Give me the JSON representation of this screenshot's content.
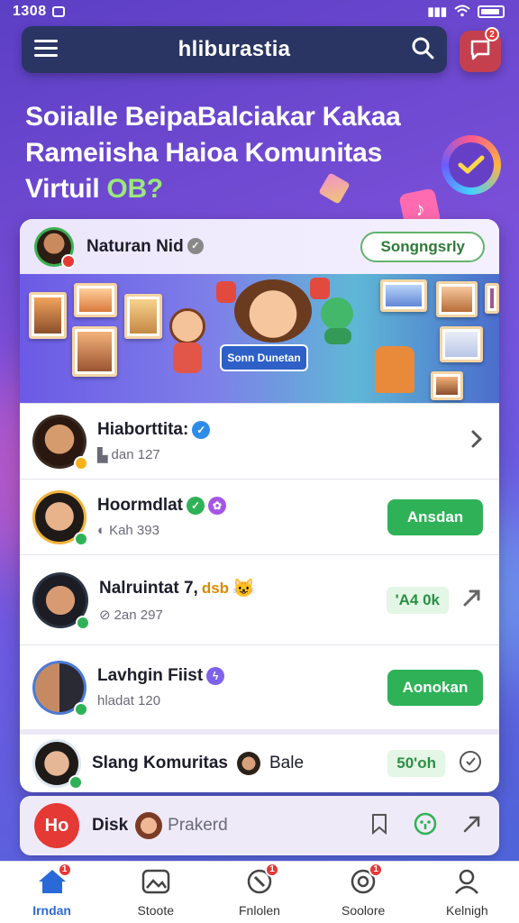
{
  "status_bar": {
    "time": "1308"
  },
  "app_bar": {
    "title": "hliburastia",
    "notification_count": "2"
  },
  "headline": {
    "line1": "Soiialle BeipaBalciakar Kakaa",
    "line2": "Rameiisha Haioa Komunitas",
    "line3_prefix": "Virtuil ",
    "line3_highlight": "OB?"
  },
  "feed": {
    "header": {
      "name": "Naturan Nid",
      "follow_label": "Songngsrly"
    },
    "banner": {
      "label": "Sonn Dunetan"
    },
    "rows": [
      {
        "name": "Hiaborttita:",
        "sub": "dan 127",
        "status_color": "#f5b21b"
      },
      {
        "name": "Hoormdlat",
        "sub": "Kah 393",
        "action": "Ansdan"
      },
      {
        "name": "Nalruintat 7,",
        "name_suffix": "dsb",
        "sub": "2an 297",
        "count": "'A4 0k"
      },
      {
        "name": "Lavhgin Fiist",
        "sub": "hladat 120",
        "action": "Aonokan"
      },
      {
        "name": "Slang Komuritas",
        "extra": "Bale",
        "count": "50'oh"
      }
    ]
  },
  "mini_bar": {
    "badge": "Ho",
    "disk_label": "Disk",
    "person_label": "Prakerd"
  },
  "bottom_nav": [
    {
      "label": "Irndan",
      "icon": "home-icon",
      "badge": "1",
      "active": true
    },
    {
      "label": "Stoote",
      "icon": "gallery-icon"
    },
    {
      "label": "Fnlolen",
      "icon": "compass-icon",
      "badge": "1"
    },
    {
      "label": "Soolore",
      "icon": "chat-icon",
      "badge": "1"
    },
    {
      "label": "Kelnigh",
      "icon": "profile-icon"
    }
  ],
  "colors": {
    "accent_green": "#2fb257",
    "brand_blue": "#2a6ad8",
    "badge_red": "#e53935"
  }
}
